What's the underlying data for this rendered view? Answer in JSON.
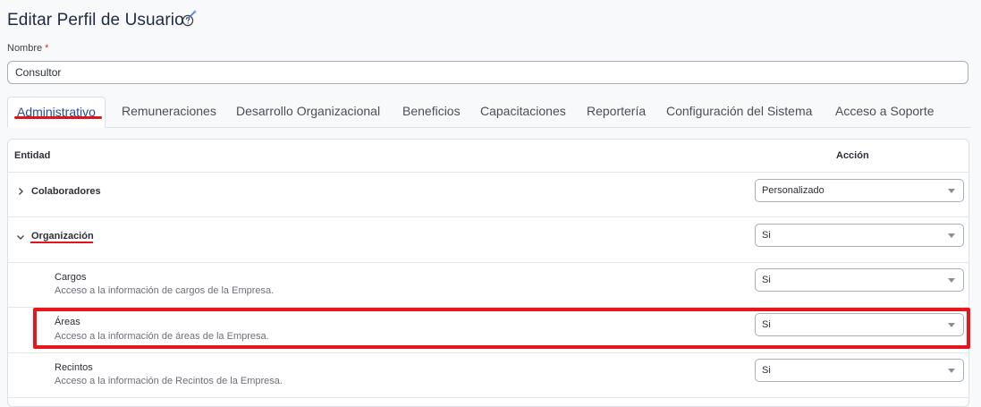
{
  "header": {
    "title": "Editar Perfil de Usuario"
  },
  "form": {
    "name_label": "Nombre",
    "required_mark": "*",
    "name_value": "Consultor"
  },
  "tabs": [
    {
      "label": "Administrativo",
      "active": true
    },
    {
      "label": "Remuneraciones"
    },
    {
      "label": "Desarrollo Organizacional"
    },
    {
      "label": "Beneficios"
    },
    {
      "label": "Capacitaciones"
    },
    {
      "label": "Reportería"
    },
    {
      "label": "Configuración del Sistema"
    },
    {
      "label": "Acceso a Soporte"
    }
  ],
  "table": {
    "col_entity": "Entidad",
    "col_action": "Acción",
    "rows": [
      {
        "title": "Colaboradores",
        "action": "Personalizado",
        "expanded": false
      },
      {
        "title": "Organización",
        "action": "Si",
        "expanded": true
      },
      {
        "title": "Cargos",
        "description": "Acceso a la información de cargos de la Empresa.",
        "action": "Si"
      },
      {
        "title": "Áreas",
        "description": "Acceso a la información de áreas de la Empresa.",
        "action": "Si"
      },
      {
        "title": "Recintos",
        "description": "Acceso a la información de Recintos de la Empresa.",
        "action": "Si"
      }
    ]
  },
  "colors": {
    "accent_red": "#e0151c",
    "tab_active_text": "#2c4a9a",
    "title_text": "#1f2a44"
  },
  "icons": {
    "help": "question-circle-icon",
    "wand": "magic-wand-icon",
    "collapsed": "chevron-right-icon",
    "expanded": "chevron-down-icon",
    "dropdown": "caret-down-icon"
  }
}
